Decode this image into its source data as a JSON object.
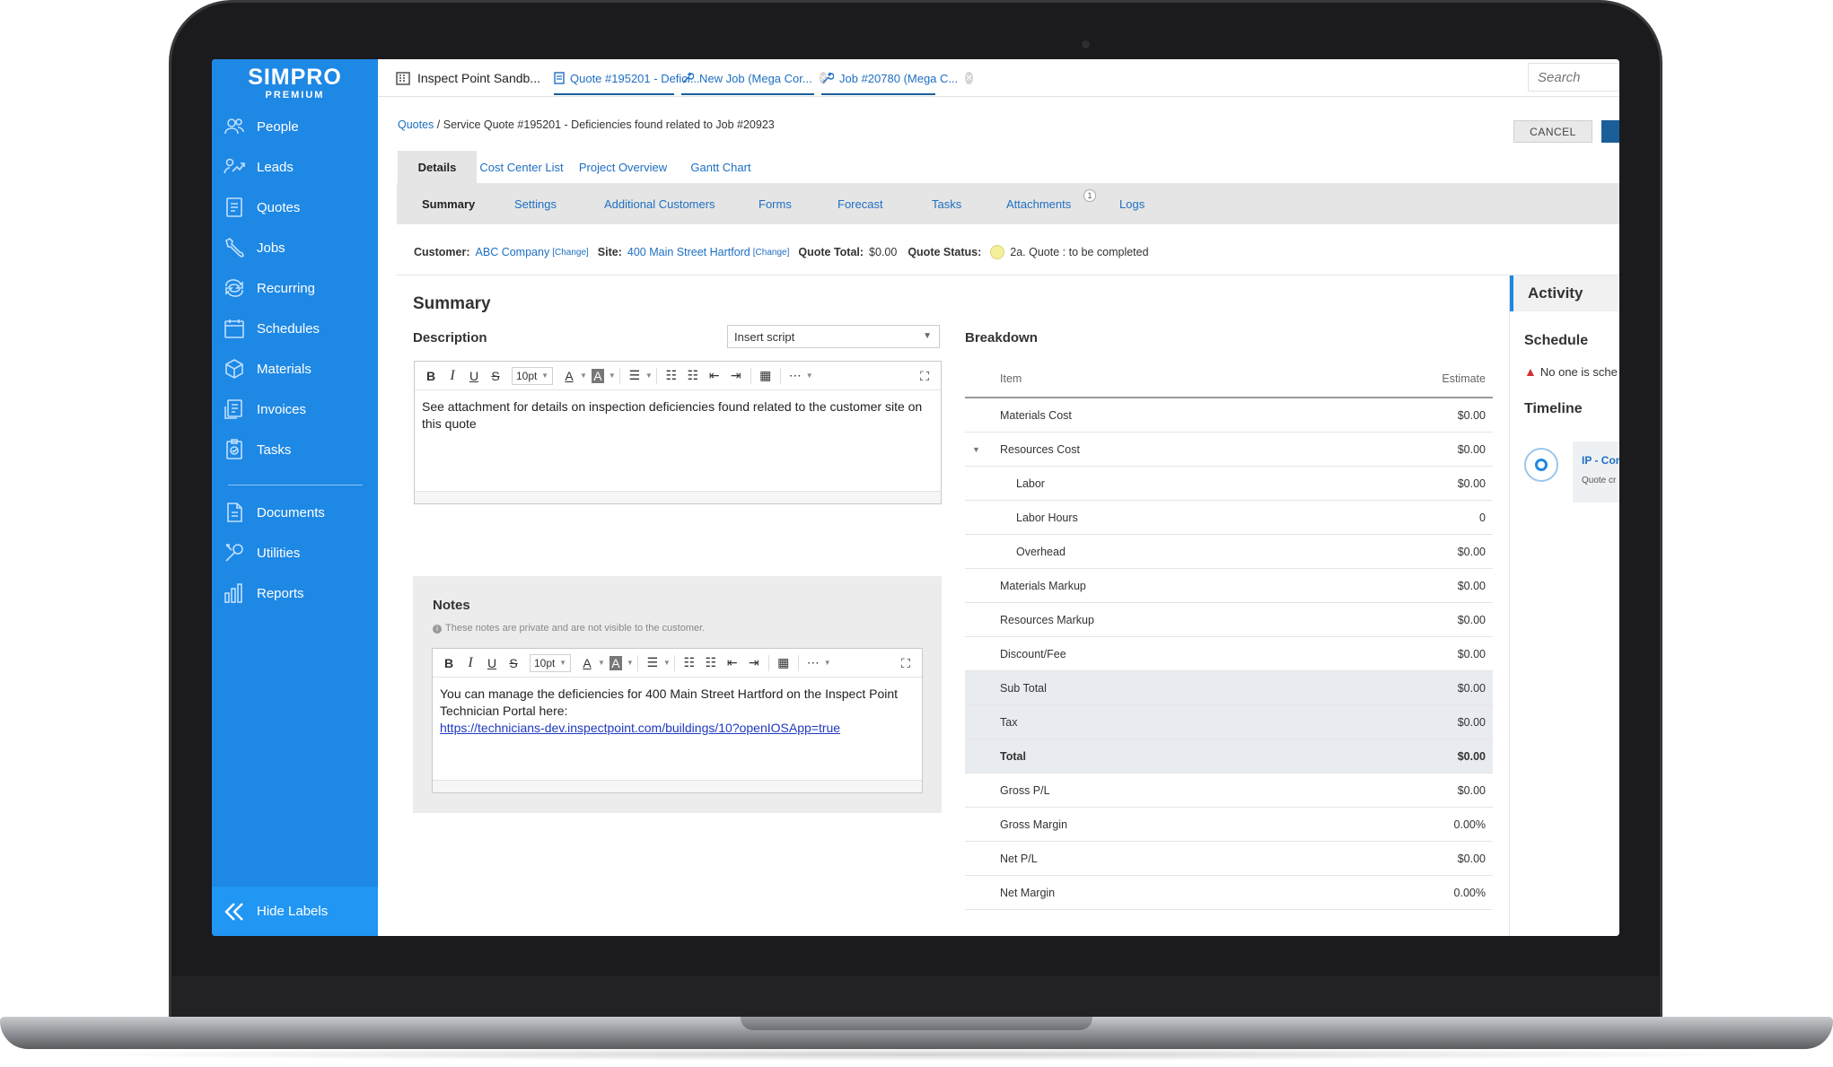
{
  "app": {
    "logo_main": "SIMPRO",
    "logo_sub": "PREMIUM"
  },
  "sidebar": {
    "items": [
      {
        "label": "People",
        "icon": "people-icon"
      },
      {
        "label": "Leads",
        "icon": "leads-icon"
      },
      {
        "label": "Quotes",
        "icon": "quotes-icon"
      },
      {
        "label": "Jobs",
        "icon": "jobs-icon"
      },
      {
        "label": "Recurring",
        "icon": "recurring-icon"
      },
      {
        "label": "Schedules",
        "icon": "schedules-icon"
      },
      {
        "label": "Materials",
        "icon": "materials-icon"
      },
      {
        "label": "Invoices",
        "icon": "invoices-icon"
      },
      {
        "label": "Tasks",
        "icon": "tasks-icon"
      },
      {
        "label": "Documents",
        "icon": "documents-icon"
      },
      {
        "label": "Utilities",
        "icon": "utilities-icon"
      },
      {
        "label": "Reports",
        "icon": "reports-icon"
      }
    ],
    "hide_labels": "Hide Labels"
  },
  "tabs": [
    {
      "label": "Inspect Point Sandb..."
    },
    {
      "label": "Quote #195201 - Defici..."
    },
    {
      "label": "New Job (Mega Cor..."
    },
    {
      "label": "Job #20780 (Mega C..."
    }
  ],
  "search": {
    "placeholder": "Search"
  },
  "breadcrumb": {
    "root": "Quotes",
    "rest": " / Service Quote #195201 - Deficiencies found related to Job #20923"
  },
  "actions": {
    "cancel": "CANCEL"
  },
  "main_tabs": [
    "Details",
    "Cost Center List",
    "Project Overview",
    "Gantt Chart"
  ],
  "sub_tabs": [
    "Summary",
    "Settings",
    "Additional Customers",
    "Forms",
    "Forecast",
    "Tasks",
    "Attachments",
    "Logs"
  ],
  "attachments_count": "1",
  "info": {
    "customer_label": "Customer:",
    "customer": "ABC Company",
    "change": "[Change]",
    "site_label": "Site:",
    "site": "400 Main Street Hartford",
    "total_label": "Quote Total:",
    "total": "$0.00",
    "status_label": "Quote Status:",
    "status": "2a. Quote : to be completed",
    "status_color": "#f4ef9a"
  },
  "summary": {
    "title": "Summary",
    "description_label": "Description",
    "script_select": "Insert script",
    "font_size": "10pt",
    "description_text": "See attachment for details on inspection deficiencies found related to the customer site on this quote"
  },
  "notes": {
    "title": "Notes",
    "hint": "These notes are private and are not visible to the customer.",
    "text": "You can manage the deficiencies for 400 Main Street Hartford on the Inspect Point Technician Portal here:",
    "link": "https://technicians-dev.inspectpoint.com/buildings/10?openIOSApp=true"
  },
  "breakdown": {
    "title": "Breakdown",
    "col_item": "Item",
    "col_estimate": "Estimate",
    "rows": [
      {
        "label": "Materials Cost",
        "value": "$0.00"
      },
      {
        "label": "Resources Cost",
        "value": "$0.00"
      },
      {
        "label": "Labor",
        "value": "$0.00"
      },
      {
        "label": "Labor Hours",
        "value": "0"
      },
      {
        "label": "Overhead",
        "value": "$0.00"
      },
      {
        "label": "Materials Markup",
        "value": "$0.00"
      },
      {
        "label": "Resources Markup",
        "value": "$0.00"
      },
      {
        "label": "Discount/Fee",
        "value": "$0.00"
      },
      {
        "label": "Sub Total",
        "value": "$0.00"
      },
      {
        "label": "Tax",
        "value": "$0.00"
      },
      {
        "label": "Total",
        "value": "$0.00"
      },
      {
        "label": "Gross P/L",
        "value": "$0.00"
      },
      {
        "label": "Gross Margin",
        "value": "0.00%"
      },
      {
        "label": "Net P/L",
        "value": "$0.00"
      },
      {
        "label": "Net Margin",
        "value": "0.00%"
      }
    ]
  },
  "activity": {
    "title": "Activity",
    "schedule_label": "Schedule",
    "schedule_warning": "No one is sche",
    "timeline_label": "Timeline",
    "timeline_card_title": "IP - Con",
    "timeline_card_sub": "Quote cr"
  },
  "colors": {
    "sidebar": "#1e88e5",
    "accent": "#1a5e9a",
    "link": "#1e6fc2"
  }
}
